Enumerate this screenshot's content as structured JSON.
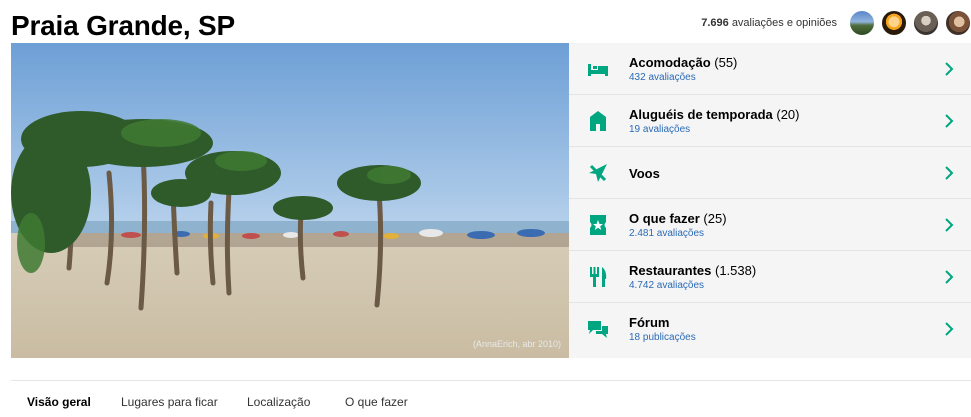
{
  "page": {
    "title": "Praia Grande, SP"
  },
  "reviews": {
    "count": "7.696",
    "label": "avaliações e opiniões"
  },
  "hero": {
    "credit": "(AnnaErich, abr 2010)"
  },
  "categories": [
    {
      "name": "Acomodação",
      "count": "(55)",
      "sub": "432 avaliações",
      "icon": "bed-icon"
    },
    {
      "name": "Aluguéis de temporada",
      "count": "(20)",
      "sub": "19 avaliações",
      "icon": "house-icon"
    },
    {
      "name": "Voos",
      "count": "",
      "sub": "",
      "icon": "plane-icon"
    },
    {
      "name": "O que fazer",
      "count": "(25)",
      "sub": "2.481 avaliações",
      "icon": "ticket-icon"
    },
    {
      "name": "Restaurantes",
      "count": "(1.538)",
      "sub": "4.742 avaliações",
      "icon": "fork-knife-icon"
    },
    {
      "name": "Fórum",
      "count": "",
      "sub": "18 publicações",
      "icon": "chat-bubbles-icon"
    }
  ],
  "tabs": [
    {
      "label": "Visão geral",
      "active": true
    },
    {
      "label": "Lugares para ficar",
      "active": false
    },
    {
      "label": "Localização",
      "active": false
    },
    {
      "label": "O que fazer",
      "active": false
    }
  ],
  "colors": {
    "icon_green": "#00a680",
    "link_blue": "#2a6ab7",
    "panel_bg": "#f5f5f5"
  }
}
